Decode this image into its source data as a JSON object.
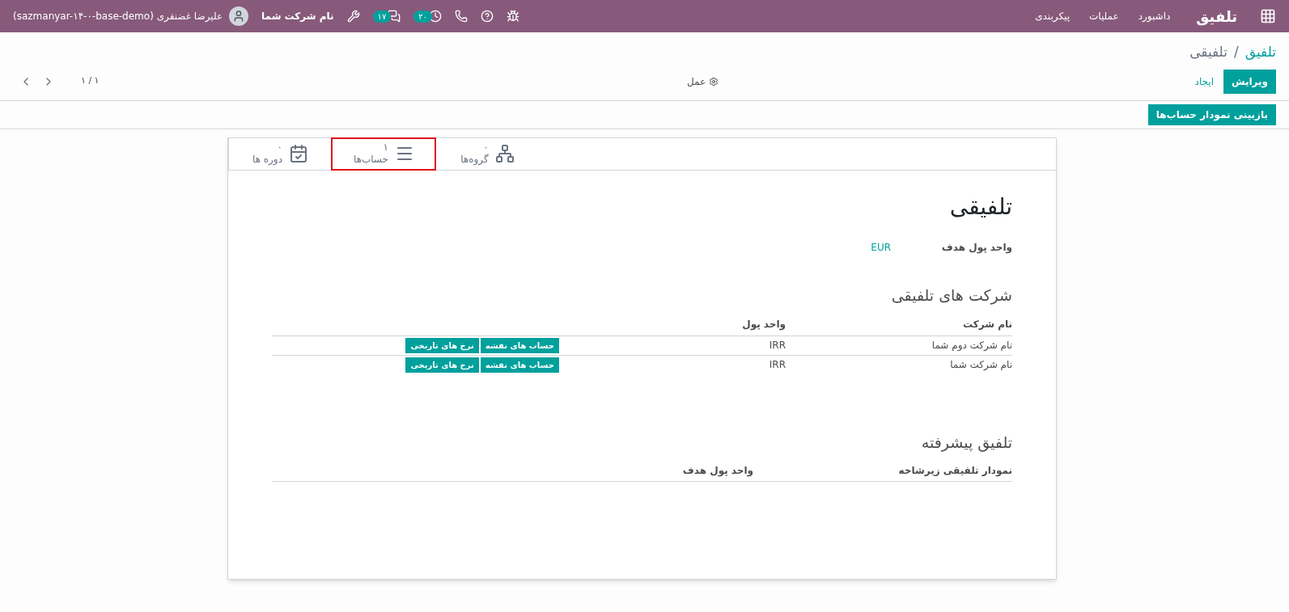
{
  "navbar": {
    "app_name": "تلفیق",
    "menus": [
      "داشبورد",
      "عملیات",
      "پیکربندی"
    ],
    "activity_count": "۲۰",
    "message_count": "۱۷",
    "company": "نام شرکت شما",
    "user": "علیرضا غضنفری (sazmanyar-۱۴-۰-base-demo)"
  },
  "breadcrumb_separator": "/",
  "breadcrumb": [
    {
      "label": "تلفیق",
      "kind": "link"
    },
    {
      "label": "تلفیقی",
      "kind": "current"
    }
  ],
  "buttons": {
    "edit": "ویرایش",
    "create": "ایجاد",
    "action": "عمل",
    "pager": "۱ / ۱"
  },
  "statusbar_button": "بازبینی نمودار حساب‌ها",
  "stat_buttons": [
    {
      "kind": "groups",
      "value": "۰",
      "label": "گروه‌ها",
      "highlighted": false
    },
    {
      "kind": "accounts",
      "value": "۱",
      "label": "حساب‌ها",
      "highlighted": true
    },
    {
      "kind": "periods",
      "value": "۰",
      "label": "دوره ها",
      "highlighted": false
    }
  ],
  "title": "تلفیقی",
  "target_currency": {
    "label": "واحد پول هدف",
    "value": "EUR"
  },
  "companies": {
    "heading": "شرکت های تلفیقی",
    "columns": [
      "نام شرکت",
      "واحد پول"
    ],
    "rows": [
      {
        "name": "نام شرکت دوم شما",
        "currency": "IRR",
        "actions": [
          "حساب های نقشه",
          "نرخ های تاریخی"
        ]
      },
      {
        "name": "نام شرکت شما",
        "currency": "IRR",
        "actions": [
          "حساب های نقشه",
          "نرخ های تاریخی"
        ]
      }
    ]
  },
  "advanced": {
    "heading": "تلفیق پیشرفته",
    "columns": [
      "نمودار تلفیقی زیرشاخه",
      "واحد پول هدف"
    ]
  }
}
